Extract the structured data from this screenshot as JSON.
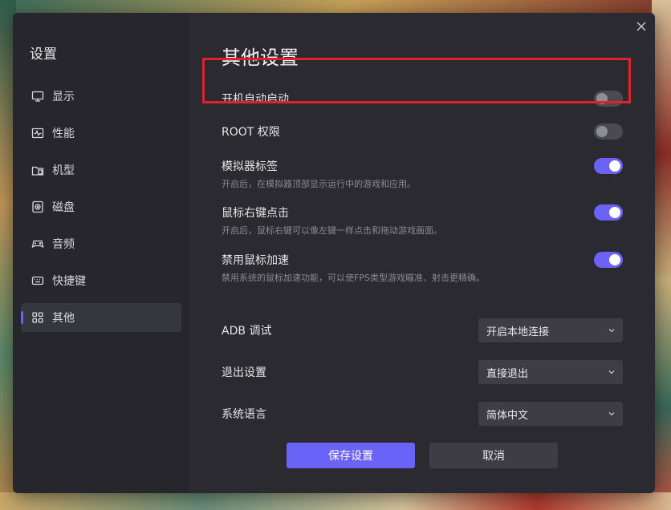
{
  "sidebar": {
    "title": "设置",
    "items": [
      {
        "label": "显示",
        "icon": "monitor-icon"
      },
      {
        "label": "性能",
        "icon": "pulse-icon"
      },
      {
        "label": "机型",
        "icon": "device-icon"
      },
      {
        "label": "磁盘",
        "icon": "disk-icon"
      },
      {
        "label": "音频",
        "icon": "gamepad-icon"
      },
      {
        "label": "快捷键",
        "icon": "keyboard-icon"
      },
      {
        "label": "其他",
        "icon": "grid-icon",
        "active": true
      }
    ]
  },
  "main": {
    "title": "其他设置",
    "toggles": [
      {
        "label": "开机自动启动",
        "description": "",
        "enabled": false
      },
      {
        "label": "ROOT 权限",
        "description": "",
        "enabled": false
      },
      {
        "label": "模拟器标签",
        "description": "开启后，在模拟器顶部显示运行中的游戏和应用。",
        "enabled": true
      },
      {
        "label": "鼠标右键点击",
        "description": "开启后，鼠标右键可以像左键一样点击和拖动游戏画面。",
        "enabled": true
      },
      {
        "label": "禁用鼠标加速",
        "description": "禁用系统的鼠标加速功能，可以使FPS类型游戏瞄准、射击更精确。",
        "enabled": true
      }
    ],
    "selects": [
      {
        "label": "ADB 调试",
        "value": "开启本地连接"
      },
      {
        "label": "退出设置",
        "value": "直接退出"
      },
      {
        "label": "系统语言",
        "value": "简体中文"
      }
    ],
    "save_label": "保存设置",
    "cancel_label": "取消"
  },
  "colors": {
    "accent": "#6b63f7",
    "highlight": "#e0202a",
    "sidebar_bg": "#26262c",
    "main_bg": "#2b2a31"
  }
}
